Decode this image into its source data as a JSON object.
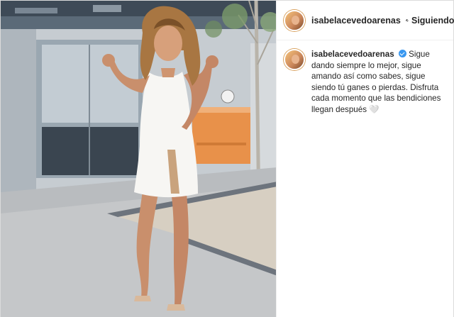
{
  "post": {
    "username": "isabelacevedoarenas",
    "follow_status": "Siguiendo",
    "separator": "•",
    "caption": "Sigue dando siempre lo mejor, sigue amando así como sabes, sigue siendo tú ganes o pierdas. Disfruta cada momento que las bendiciones llegan después 🤍"
  },
  "colors": {
    "verified_badge": "#3897f0",
    "border": "#dbdbdb",
    "text": "#262626"
  },
  "icons": {
    "verified": "verified-badge-icon"
  }
}
